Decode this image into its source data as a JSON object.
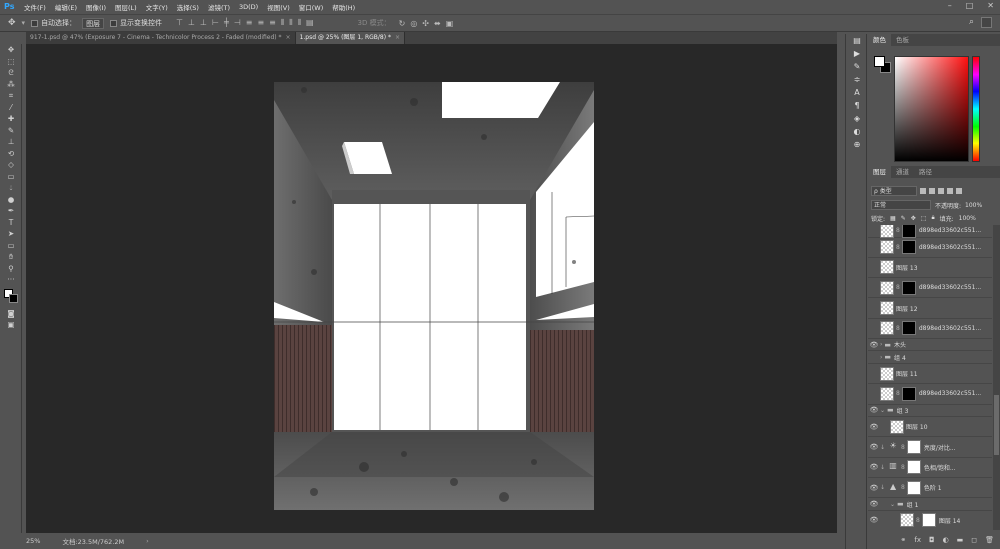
{
  "menu": {
    "logo": "Ps",
    "items": [
      "文件(F)",
      "编辑(E)",
      "图像(I)",
      "图层(L)",
      "文字(Y)",
      "选择(S)",
      "滤镜(T)",
      "3D(D)",
      "视图(V)",
      "窗口(W)",
      "帮助(H)"
    ]
  },
  "options": {
    "auto_select_label": "自动选择：",
    "auto_select_value": "图层",
    "show_transform_label": "显示变换控件",
    "mode3d_label": "3D 模式："
  },
  "tabs": [
    {
      "label": "917-1.psd @ 47% (Exposure 7 - Cinema - Technicolor Process 2 - Faded (modified) *"
    },
    {
      "label": "1.psd @ 25% (图层 1, RGB/8) *"
    }
  ],
  "status": {
    "zoom": "25%",
    "doc": "文档:23.5M/762.2M"
  },
  "color_panel": {
    "tabs": [
      "颜色",
      "色板"
    ],
    "fg": "#ffffff",
    "bg": "#000000",
    "hue_color": "#ff1010"
  },
  "layers_panel": {
    "tabs": [
      "图层",
      "通道",
      "路径"
    ],
    "kind": "ρ 类型",
    "blend": "正常",
    "opacity_label": "不透明度:",
    "opacity": "100%",
    "lock_label": "锁定:",
    "fill_label": "填充:",
    "fill": "100%",
    "layers": [
      {
        "name": "d898ed33602c551...",
        "type": "mask"
      },
      {
        "name": "d898ed33602c551...",
        "type": "mask"
      },
      {
        "name": "图层 13",
        "type": "pixel"
      },
      {
        "name": "d898ed33602c551...",
        "type": "mask"
      },
      {
        "name": "图层 12",
        "type": "pixel"
      },
      {
        "name": "d898ed33602c551...",
        "type": "mask"
      },
      {
        "name": "木头",
        "type": "group"
      },
      {
        "name": "组 4",
        "type": "group"
      },
      {
        "name": "图层 11",
        "type": "pixel"
      },
      {
        "name": "d898ed33602c551...",
        "type": "mask"
      },
      {
        "name": "组 3",
        "type": "group"
      },
      {
        "name": "图层 10",
        "type": "pixel"
      },
      {
        "name": "亮度/对比...",
        "type": "adj"
      },
      {
        "name": "色相/饱和...",
        "type": "adj"
      },
      {
        "name": "色阶 1",
        "type": "adj"
      },
      {
        "name": "组 1",
        "type": "group"
      },
      {
        "name": "图层 14",
        "type": "pixel"
      }
    ]
  }
}
